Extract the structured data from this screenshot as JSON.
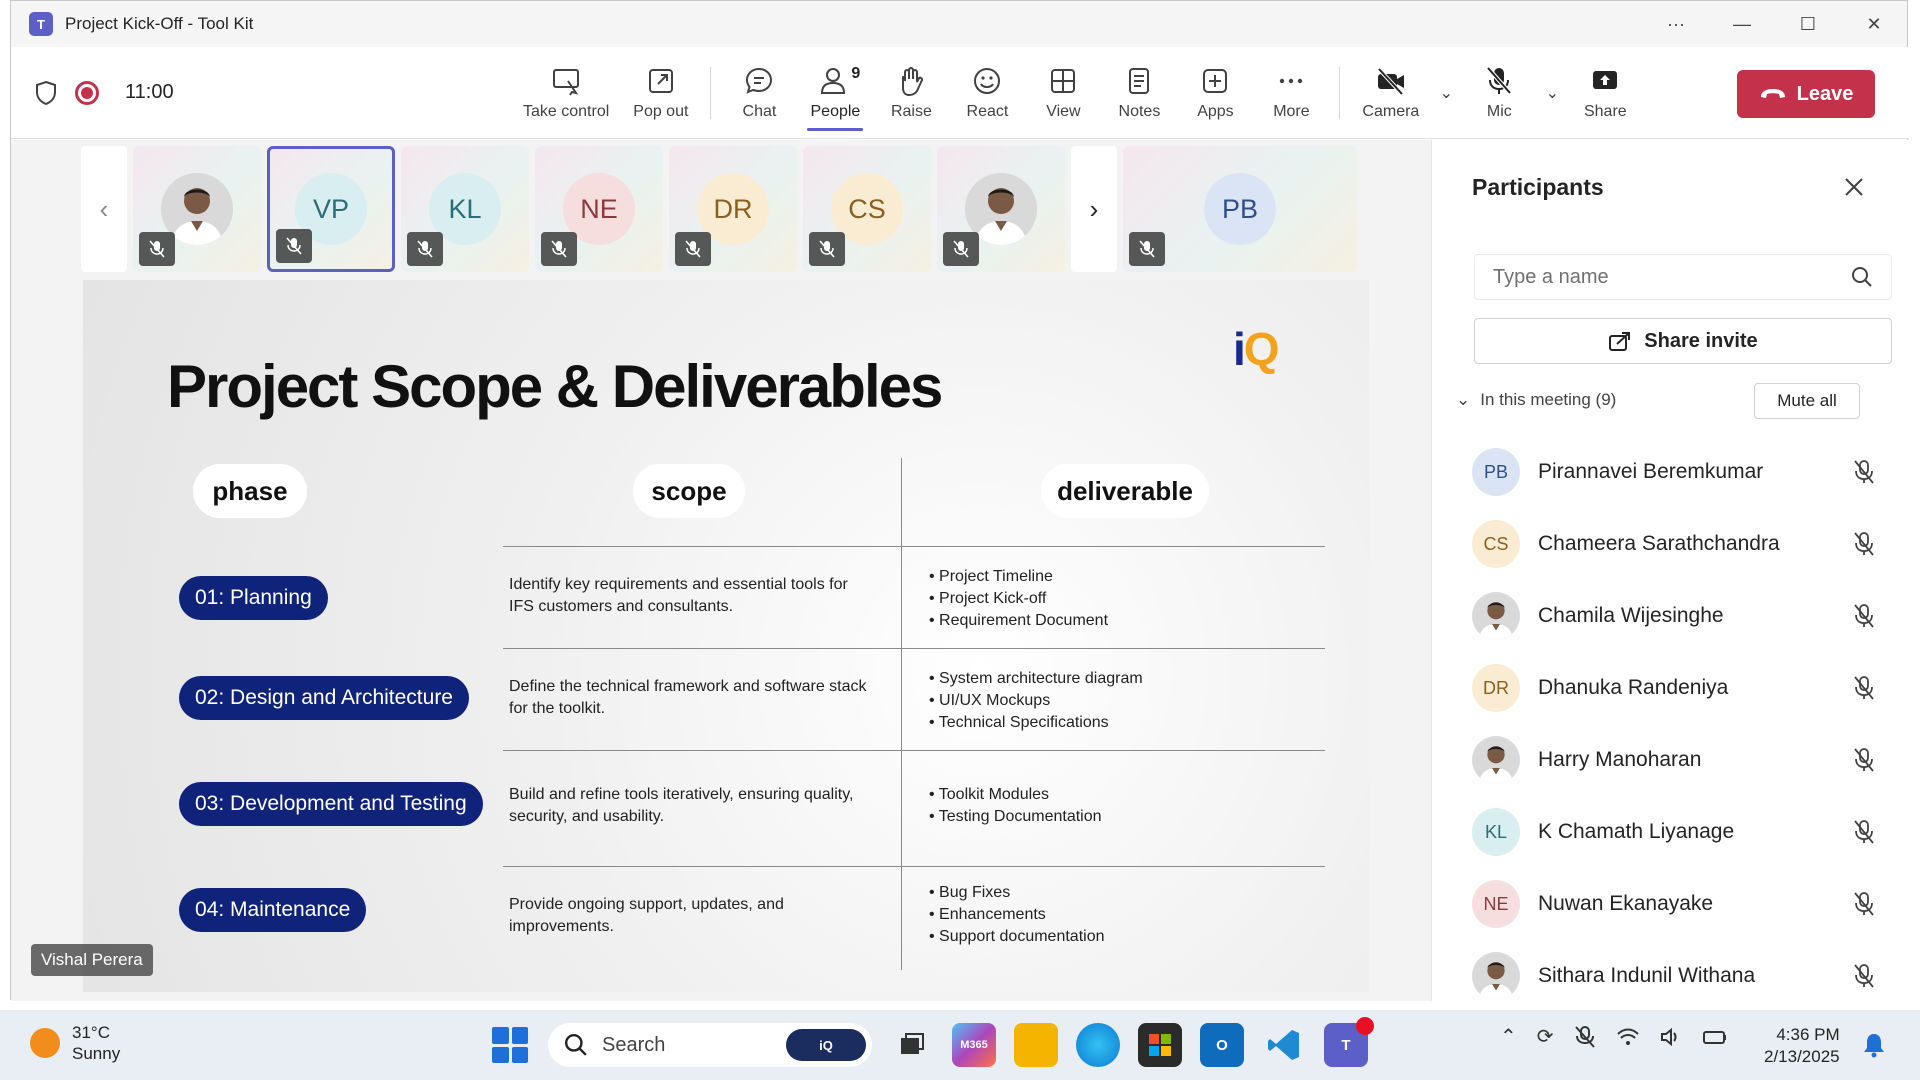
{
  "window": {
    "title": "Project Kick-Off - Tool Kit",
    "app_logo": "T"
  },
  "meeting": {
    "timer": "11:00"
  },
  "toolbar": {
    "take_control": "Take control",
    "pop_out": "Pop out",
    "chat": "Chat",
    "people": "People",
    "people_count": "9",
    "raise": "Raise",
    "react": "React",
    "view": "View",
    "notes": "Notes",
    "apps": "Apps",
    "more": "More",
    "camera": "Camera",
    "mic": "Mic",
    "share": "Share",
    "leave": "Leave"
  },
  "strip": {
    "tiles": [
      {
        "initials": "",
        "photo": true
      },
      {
        "initials": "VP",
        "bg": "#d8eef0",
        "fg": "#2c6e78",
        "selected": true
      },
      {
        "initials": "KL",
        "bg": "#d8eef0",
        "fg": "#2c6e78"
      },
      {
        "initials": "NE",
        "bg": "#f6dede",
        "fg": "#8a3b3b"
      },
      {
        "initials": "DR",
        "bg": "#f9ecd2",
        "fg": "#8a6020"
      },
      {
        "initials": "CS",
        "bg": "#f9ecd2",
        "fg": "#8a6020"
      },
      {
        "initials": "",
        "photo": true
      }
    ],
    "wide_tile": {
      "initials": "PB",
      "bg": "#dbe4f4",
      "fg": "#2f4f8a"
    }
  },
  "slide": {
    "logo_main": "i",
    "logo_accent": "Q",
    "title": "Project Scope & Deliverables",
    "headers": {
      "phase": "phase",
      "scope": "scope",
      "deliverable": "deliverable"
    },
    "rows": [
      {
        "phase": "01: Planning",
        "scope": "Identify key requirements and essential tools for IFS customers and consultants.",
        "deliverables": [
          "Project Timeline",
          "Project Kick-off",
          "Requirement Document"
        ]
      },
      {
        "phase": "02: Design and Architecture",
        "scope": "Define the technical framework and software stack for the toolkit.",
        "deliverables": [
          "System architecture diagram",
          "UI/UX Mockups",
          "Technical Specifications"
        ]
      },
      {
        "phase": "03: Development and Testing",
        "scope": "Build and refine tools iteratively, ensuring quality, security, and usability.",
        "deliverables": [
          "Toolkit Modules",
          "Testing Documentation"
        ]
      },
      {
        "phase": "04: Maintenance",
        "scope": "Provide ongoing support, updates, and improvements.",
        "deliverables": [
          "Bug Fixes",
          "Enhancements",
          "Support documentation"
        ]
      }
    ]
  },
  "presenter_tag": "Vishal Perera",
  "panel": {
    "title": "Participants",
    "search_placeholder": "Type a name",
    "share_invite": "Share invite",
    "in_meeting": "In this meeting (9)",
    "mute_all": "Mute all",
    "participants": [
      {
        "initials": "PB",
        "name": "Pirannavei Beremkumar",
        "bg": "#dbe4f4",
        "fg": "#2f4f8a"
      },
      {
        "initials": "CS",
        "name": "Chameera Sarathchandra",
        "bg": "#f9ecd2",
        "fg": "#8a6020"
      },
      {
        "initials": "",
        "name": "Chamila Wijesinghe",
        "photo": true
      },
      {
        "initials": "DR",
        "name": "Dhanuka Randeniya",
        "bg": "#f9ecd2",
        "fg": "#8a6020"
      },
      {
        "initials": "",
        "name": "Harry Manoharan",
        "photo": true
      },
      {
        "initials": "KL",
        "name": "K Chamath Liyanage",
        "bg": "#d8eef0",
        "fg": "#2c6e78"
      },
      {
        "initials": "NE",
        "name": "Nuwan Ekanayake",
        "bg": "#f6dede",
        "fg": "#8a3b3b"
      },
      {
        "initials": "",
        "name": "Sithara Indunil Withana",
        "photo": true
      }
    ]
  },
  "taskbar": {
    "temperature": "31°C",
    "weather": "Sunny",
    "search": "Search",
    "search_badge": "iQ",
    "m365": "M365",
    "time": "4:36 PM",
    "date": "2/13/2025"
  },
  "colors": {
    "accent": "#5b5fc7",
    "leave": "#c4314b",
    "phase_pill": "#10237a"
  }
}
